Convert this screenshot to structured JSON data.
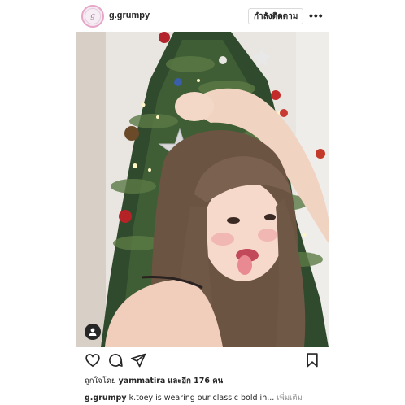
{
  "header": {
    "username": "g.grumpy",
    "avatar_letter": "g",
    "follow_label": "กำลังติดตาม",
    "more_icon": "more-horizontal-icon"
  },
  "photo": {
    "description_icon": "user-tag-icon"
  },
  "actions": {
    "like_icon": "heart-icon",
    "comment_icon": "comment-icon",
    "share_icon": "paper-plane-icon",
    "save_icon": "bookmark-icon"
  },
  "likes": {
    "prefix": "ถูกใจโดย",
    "user": "yammatira",
    "suffix": "และอีก 176 คน"
  },
  "caption": {
    "username": "g.grumpy",
    "text": "k.toey is wearing our classic bold in...",
    "more_label": "เพิ่มเติม"
  },
  "colors": {
    "text": "#262626",
    "muted": "#8e8e8e",
    "border": "#dbdbdb",
    "story_ring": "#e7a6c8"
  }
}
